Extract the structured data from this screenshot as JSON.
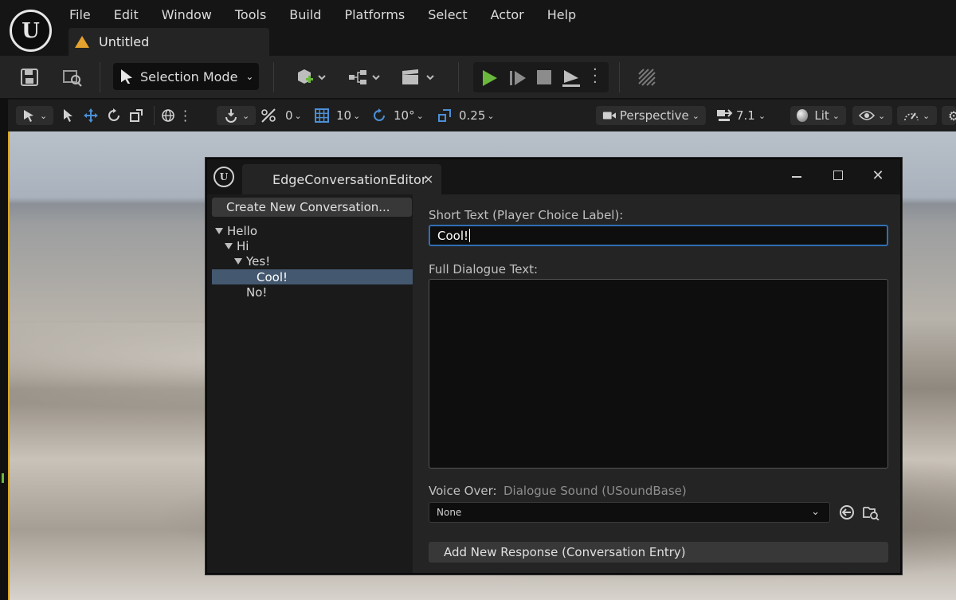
{
  "app": {
    "document_title": "Untitled",
    "menu": [
      "File",
      "Edit",
      "Window",
      "Tools",
      "Build",
      "Platforms",
      "Select",
      "Actor",
      "Help"
    ]
  },
  "toolbar": {
    "selection_mode_label": "Selection Mode"
  },
  "viewport_toolbar": {
    "rotation_snap_value": "0",
    "grid_snap_value": "10",
    "angle_snap_value": "10°",
    "scale_snap_value": "0.25",
    "view_mode_label": "Perspective",
    "camera_speed_value": "7.1",
    "lit_mode_label": "Lit"
  },
  "editor": {
    "tab_title": "EdgeConversationEditor",
    "create_button_label": "Create New Conversation...",
    "tree": [
      {
        "label": "Hello",
        "depth": 0,
        "expanded": true,
        "selected": false
      },
      {
        "label": "Hi",
        "depth": 1,
        "expanded": true,
        "selected": false
      },
      {
        "label": "Yes!",
        "depth": 2,
        "expanded": true,
        "selected": false
      },
      {
        "label": "Cool!",
        "depth": 3,
        "expanded": false,
        "selected": true
      },
      {
        "label": "No!",
        "depth": 2,
        "expanded": false,
        "selected": false
      }
    ],
    "short_text_label": "Short Text (Player Choice Label):",
    "short_text_value": "Cool!",
    "full_text_label": "Full Dialogue Text:",
    "full_text_value": "",
    "voice_over_label": "Voice Over:",
    "voice_over_hint": "Dialogue Sound (USoundBase)",
    "voice_over_value": "None",
    "add_response_label": "Add New Response (Conversation Entry)"
  },
  "colors": {
    "accent_blue": "#2f6fb5",
    "selection_row": "#445870",
    "play_green": "#6ab83c",
    "warning_orange": "#e6a22e"
  }
}
